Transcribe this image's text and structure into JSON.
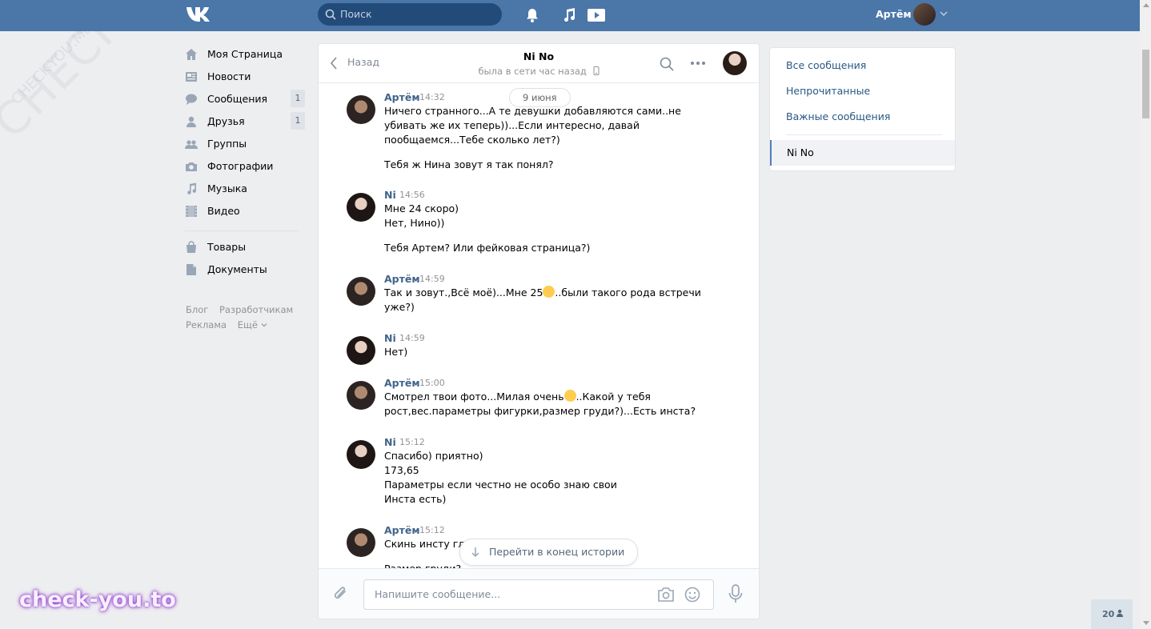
{
  "header": {
    "search_placeholder": "Поиск",
    "user_name": "Артём",
    "icons": [
      "vk-logo-icon",
      "search-icon",
      "bell-icon",
      "music-icon",
      "video-icon",
      "chevron-down-icon"
    ]
  },
  "left_nav": {
    "items": [
      {
        "label": "Моя Страница",
        "icon": "home-icon"
      },
      {
        "label": "Новости",
        "icon": "news-icon"
      },
      {
        "label": "Сообщения",
        "icon": "messages-icon",
        "count": "1"
      },
      {
        "label": "Друзья",
        "icon": "friends-icon",
        "count": "1"
      },
      {
        "label": "Группы",
        "icon": "groups-icon"
      },
      {
        "label": "Фотографии",
        "icon": "camera-icon"
      },
      {
        "label": "Музыка",
        "icon": "music-icon"
      },
      {
        "label": "Видео",
        "icon": "video-icon"
      },
      {
        "label": "Товары",
        "icon": "bag-icon"
      },
      {
        "label": "Документы",
        "icon": "document-icon"
      }
    ],
    "footer": [
      "Блог",
      "Разработчикам",
      "Реклама",
      "Ещё"
    ]
  },
  "chat": {
    "back_label": "Назад",
    "peer_name": "Ni No",
    "peer_status": "была в сети час назад",
    "date_label": "9 июня",
    "messages": [
      {
        "author": "Артём",
        "time": "14:32",
        "side": "me",
        "lines": [
          "Ничего странного...А те девушки добавляются сами..не",
          "убивать же их теперь))...Если интересно, давай",
          "пообщаемся...Тебе сколько лет?)",
          "",
          "Тебя ж Нина зовут я так понял?"
        ]
      },
      {
        "author": "Ni",
        "time": "14:56",
        "side": "peer",
        "lines": [
          "Мне 24 скоро)",
          "Нет, Нино))",
          "",
          "Тебя Артем? Или фейковая страница?)"
        ]
      },
      {
        "author": "Артём",
        "time": "14:59",
        "side": "me",
        "lines": [
          "Так и зовут.,Всё моё)...Мне 25",
          "..были такого рода встречи",
          "уже?)"
        ]
      },
      {
        "author": "Ni",
        "time": "14:59",
        "side": "peer",
        "lines": [
          "Нет)"
        ]
      },
      {
        "author": "Артём",
        "time": "15:00",
        "side": "me",
        "lines": [
          "Смотрел твои фото...Милая очень",
          "..Какой у тебя",
          "рост,вес.параметры фигурки,размер груди?)...Есть инста?"
        ]
      },
      {
        "author": "Ni",
        "time": "15:12",
        "side": "peer",
        "lines": [
          "Спасибо) приятно)",
          "173,65",
          "Параметры если честно не особо знаю свои",
          "Инста есть)"
        ]
      },
      {
        "author": "Артём",
        "time": "15:12",
        "side": "me",
        "lines": [
          "Скинь инсту гляну)",
          "",
          "Размер груди?"
        ]
      }
    ],
    "jump_label": "Перейти в конец истории",
    "compose_placeholder": "Напишите сообщение..."
  },
  "right_panel": {
    "items": [
      "Все сообщения",
      "Непрочитанные",
      "Важные сообщения"
    ],
    "selected": "Ni No"
  },
  "watermark": {
    "big": "CHECK-YOU.ME",
    "small": "CHECK-YOU.ME",
    "bottom": "check-you.to"
  },
  "online_count": "20",
  "colors": {
    "header": "#4a76a8",
    "link": "#2a5885",
    "author": "#42648b",
    "page_bg": "#edeef0"
  }
}
